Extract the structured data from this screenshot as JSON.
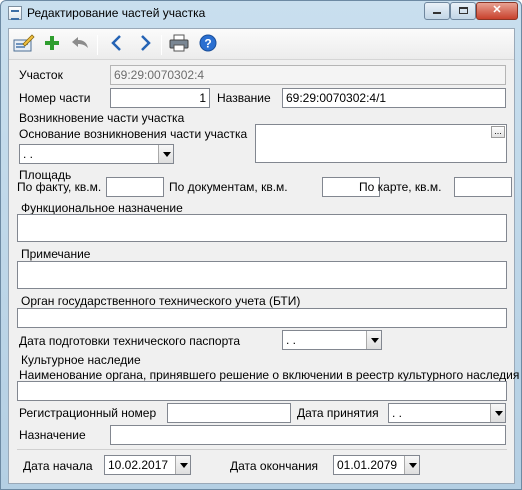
{
  "window": {
    "title": "Редактирование частей участка"
  },
  "toolbar": {
    "edit_icon": "edit-record-icon",
    "add_icon": "plus-icon",
    "undo_icon": "undo-icon",
    "prev_icon": "chevron-left-icon",
    "next_icon": "chevron-right-icon",
    "print_icon": "printer-icon",
    "help_icon": "help-icon",
    "help_glyph": "?"
  },
  "colors": {
    "accent_green": "#2f9e2f",
    "accent_blue": "#2463b5",
    "help_blue": "#2a6fd1"
  },
  "form": {
    "uchastok_label": "Участок",
    "uchastok_value": "69:29:0070302:4",
    "part_number_label": "Номер части",
    "part_number_value": "1",
    "name_label": "Название",
    "name_value": "69:29:0070302:4/1",
    "origin_section": "Возникновение части участка",
    "origin_basis_label": "Основание возникновения части участка",
    "origin_basis_select": ". .",
    "origin_basis_text": "",
    "ellipsis_label": "...",
    "area_section": "Площадь",
    "area_actual_label": "По факту, кв.м.",
    "area_actual_value": "",
    "area_docs_label": "По документам, кв.м.",
    "area_docs_value": "",
    "area_map_label": "По карте, кв.м.",
    "area_map_value": "",
    "func_purpose_label": "Функциональное назначение",
    "func_purpose_value": "",
    "note_label": "Примечание",
    "note_value": "",
    "bti_label": "Орган государственного технического учета (БТИ)",
    "bti_value": "",
    "tech_passport_date_label": "Дата подготовки технического паспорта",
    "tech_passport_date_value": ". .",
    "cultural_section": "Культурное наследие",
    "authority_label": "Наименование органа, принявшего решение о включении в реестр культурного наследия",
    "authority_value": "",
    "reg_number_label": "Регистрационный номер",
    "reg_number_value": "",
    "accept_date_label": "Дата принятия",
    "accept_date_value": ". .",
    "purpose_label": "Назначение",
    "purpose_value": "",
    "start_date_label": "Дата начала",
    "start_date_value": "10.02.2017",
    "end_date_label": "Дата окончания",
    "end_date_value": "01.01.2079"
  }
}
